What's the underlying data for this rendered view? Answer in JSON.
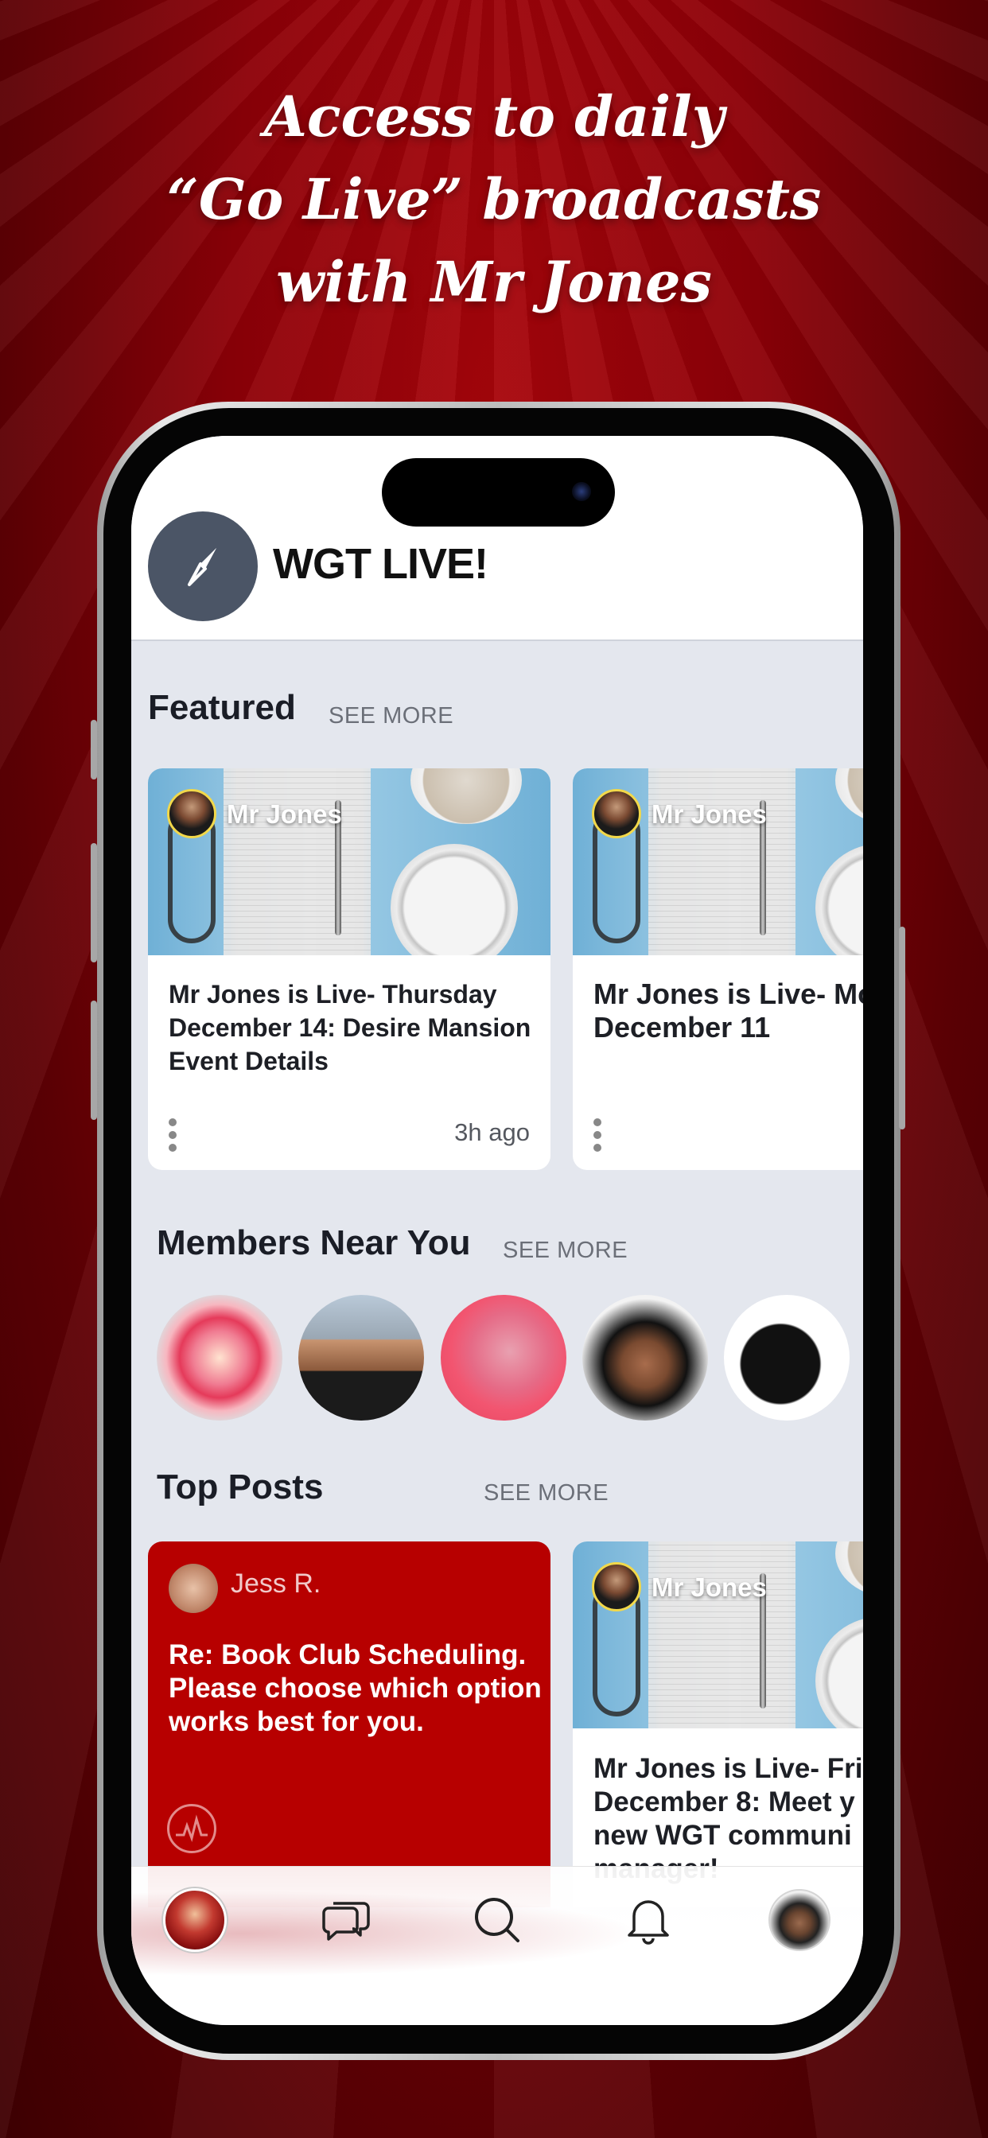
{
  "headline": {
    "line1": "Access to daily",
    "line2": "“Go Live” broadcasts",
    "line3": "with Mr Jones"
  },
  "app": {
    "title": "WGT LIVE!",
    "logo_icon": "compass-icon"
  },
  "featured": {
    "title": "Featured",
    "see_more": "SEE MORE",
    "cards": [
      {
        "author": "Mr Jones",
        "text": "Mr Jones is Live- Thursday December 14: Desire Mansion Event Details",
        "time": "3h ago"
      },
      {
        "author": "Mr Jones",
        "text": "Mr Jones is Live- Mo December 11",
        "time": ""
      }
    ]
  },
  "members": {
    "title": "Members Near You",
    "see_more": "SEE MORE",
    "count_visible": 5
  },
  "top_posts": {
    "title": "Top Posts",
    "see_more": "SEE MORE",
    "posts": [
      {
        "author": "Jess R.",
        "text": "Re: Book Club Scheduling. Please choose which option works best for you."
      },
      {
        "author": "Mr Jones",
        "text": "Mr Jones is Live- Fri December 8: Meet y new WGT communi manager!"
      }
    ]
  },
  "tabbar": {
    "items": [
      "home-avatar-icon",
      "chat-bubbles-icon",
      "search-icon",
      "bell-icon",
      "profile-avatar-icon"
    ]
  },
  "colors": {
    "background": "#8d0007",
    "post_red": "#b70000",
    "screen_bg": "#e4e7ee"
  }
}
